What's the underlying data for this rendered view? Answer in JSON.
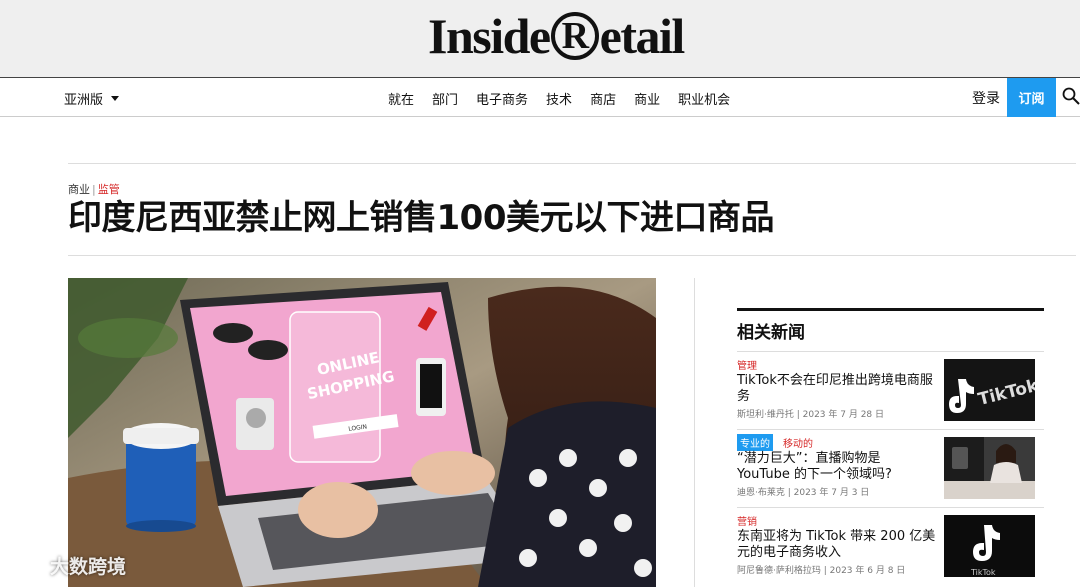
{
  "site": {
    "logo_part1": "Inside",
    "logo_reg": "R",
    "logo_part2": "etail"
  },
  "nav": {
    "edition": "亚洲版",
    "items": [
      "就在",
      "部门",
      "电子商务",
      "技术",
      "商店",
      "商业",
      "职业机会"
    ],
    "login": "登录",
    "subscribe": "订阅"
  },
  "article": {
    "category": "商业",
    "subcategory": "监管",
    "headline": "印度尼西亚禁止网上销售100美元以下进口商品",
    "hero": {
      "screen_text_1": "ONLINE",
      "screen_text_2": "SHOPPING",
      "screen_button": "LOGIN"
    }
  },
  "related": {
    "title": "相关新闻",
    "items": [
      {
        "tag1": "管理",
        "tag2": "",
        "title": "TikTok不会在印尼推出跨境电商服务",
        "meta": "斯坦利·维丹托 | 2023 年 7 月 28 日",
        "thumb_text": "TikTok"
      },
      {
        "tag1": "专业的",
        "tag2": "移动的",
        "title": "“潜力巨大”：直播购物是 YouTube 的下一个领域吗?",
        "meta": "迪恩·布莱克 | 2023 年 7 月 3 日",
        "thumb_text": ""
      },
      {
        "tag1": "营销",
        "tag2": "",
        "title": "东南亚将为 TikTok 带来 200 亿美元的电子商务收入",
        "meta": "阿尼鲁德·萨利格拉玛 | 2023 年 6 月 8 日",
        "thumb_text": "TikTok"
      }
    ]
  },
  "watermark": "大数跨境",
  "colors": {
    "accent_blue": "#1e9bf0",
    "accent_red": "#d62828",
    "masthead_bg": "#efefef"
  }
}
